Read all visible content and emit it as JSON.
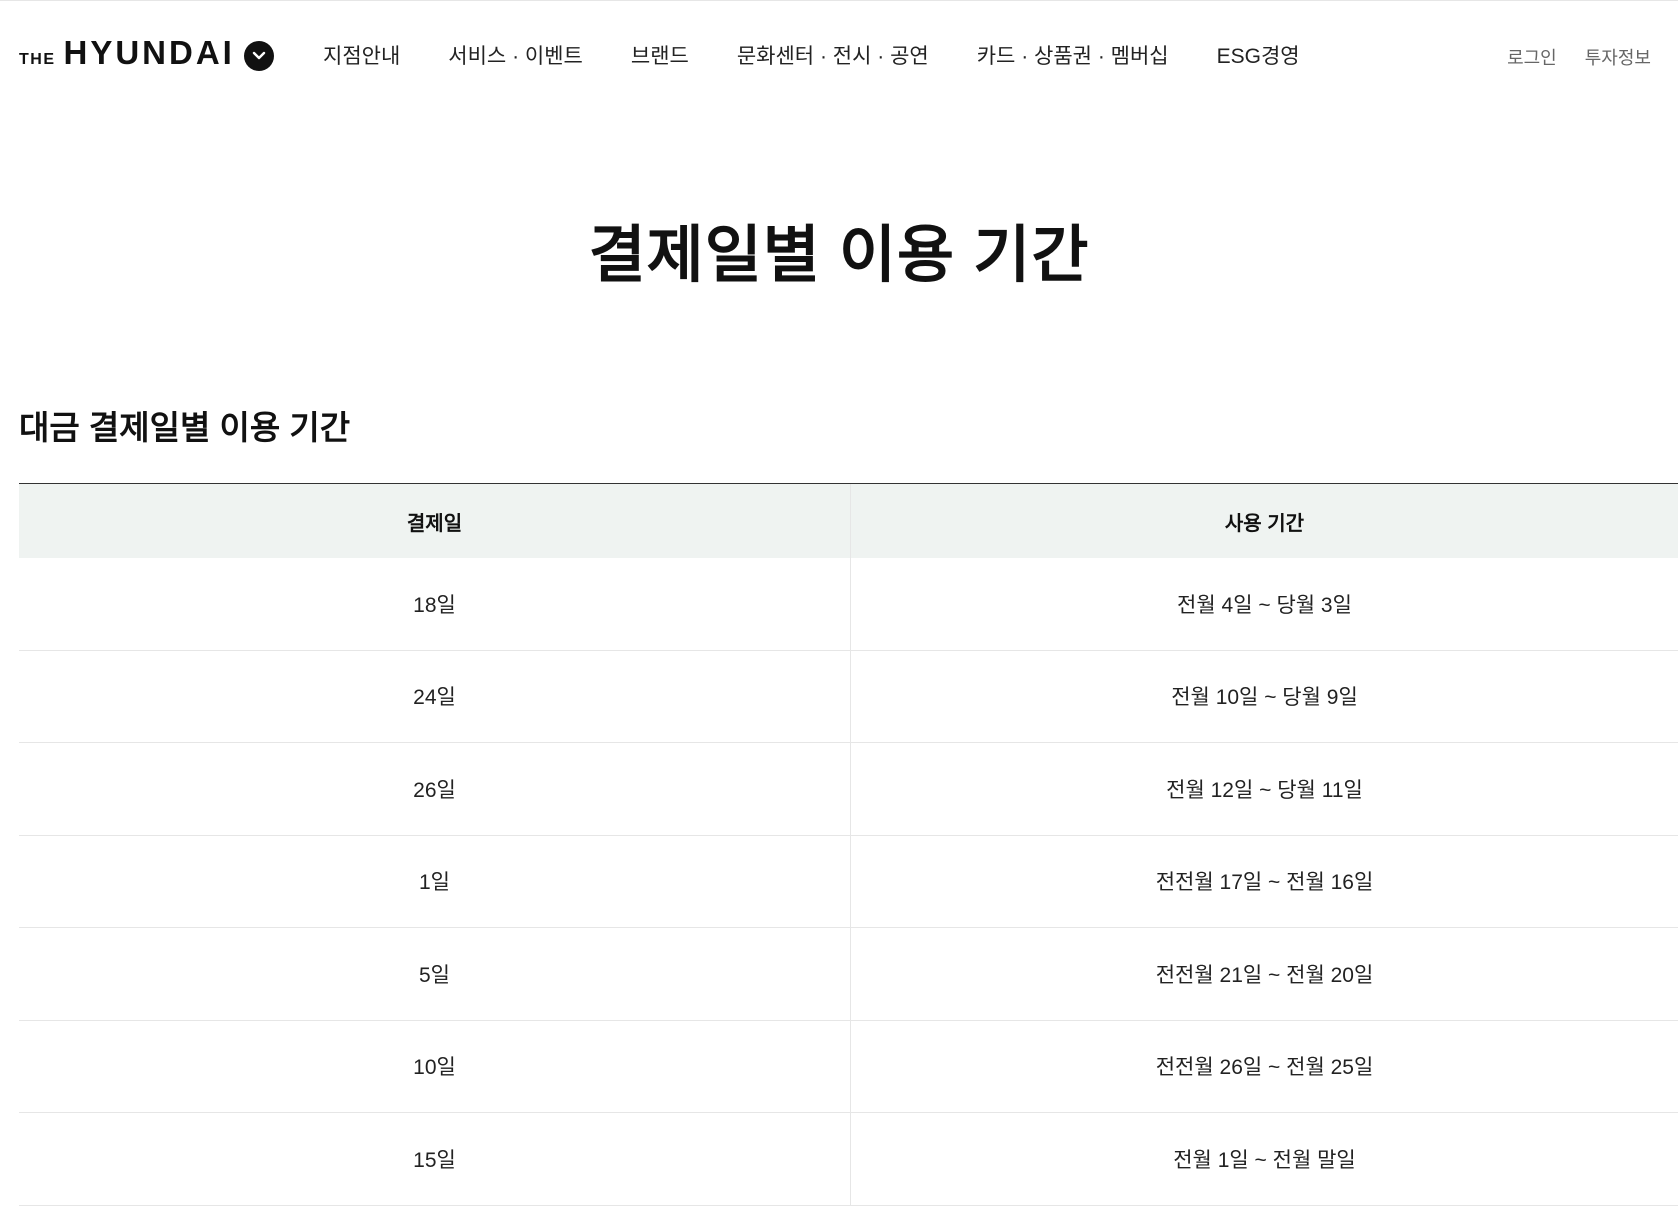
{
  "header": {
    "logo_the": "THE",
    "logo_main": "HYUNDAI",
    "nav": [
      {
        "label": "지점안내",
        "name": "nav-branch-info"
      },
      {
        "label": "서비스 · 이벤트",
        "name": "nav-service-event"
      },
      {
        "label": "브랜드",
        "name": "nav-brand"
      },
      {
        "label": "문화센터 · 전시 · 공연",
        "name": "nav-culture"
      },
      {
        "label": "카드 · 상품권 · 멤버십",
        "name": "nav-card-membership"
      },
      {
        "label": "ESG경영",
        "name": "nav-esg"
      }
    ],
    "util": [
      {
        "label": "로그인",
        "name": "login-link"
      },
      {
        "label": "투자정보",
        "name": "investor-link"
      }
    ]
  },
  "page": {
    "title": "결제일별 이용 기간",
    "section_title": "대금 결제일별 이용 기간"
  },
  "table": {
    "headers": [
      "결제일",
      "사용 기간"
    ],
    "rows": [
      [
        "18일",
        "전월 4일 ~ 당월 3일"
      ],
      [
        "24일",
        "전월 10일 ~ 당월 9일"
      ],
      [
        "26일",
        "전월 12일 ~ 당월 11일"
      ],
      [
        "1일",
        "전전월 17일 ~ 전월 16일"
      ],
      [
        "5일",
        "전전월 21일 ~ 전월 20일"
      ],
      [
        "10일",
        "전전월 26일 ~ 전월 25일"
      ],
      [
        "15일",
        "전월 1일 ~ 전월 말일"
      ]
    ]
  },
  "icons": {
    "logo_toggle": "chevron-down-icon"
  }
}
